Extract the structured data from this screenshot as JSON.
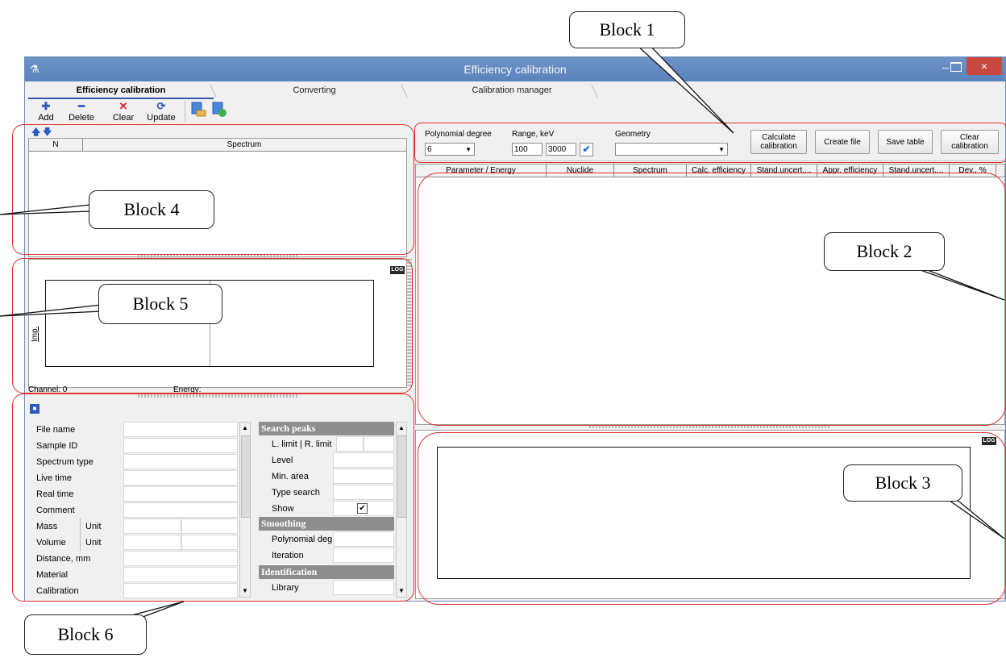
{
  "window": {
    "title": "Efficiency calibration",
    "controls": {
      "minimize": "–",
      "maximize": "☐",
      "close": "×"
    }
  },
  "tabs": [
    "Efficiency calibration",
    "Converting",
    "Calibration manager"
  ],
  "toolbar": {
    "add": "Add",
    "delete": "Delete",
    "clear": "Clear",
    "update": "Update"
  },
  "spectra_list": {
    "headers": {
      "n": "N",
      "spectrum": "Spectrum"
    }
  },
  "spectrum_view": {
    "log": "LOG",
    "y_label": "Imp.",
    "channel": "Channel: 0",
    "energy": "Energy:"
  },
  "properties": {
    "rows": [
      "File name",
      "Sample ID",
      "Spectrum type",
      "Live time",
      "Real time",
      "Comment",
      "Mass",
      "Volume",
      "Distance, mm",
      "Material",
      "Calibration"
    ],
    "unit_label": "Unit"
  },
  "settings": {
    "search_peaks": "Search peaks",
    "l_limit": "L. limit",
    "r_limit": "R. limit",
    "level": "Level",
    "min_area": "Min. area",
    "type_search": "Type search",
    "show": "Show",
    "show_checked": true,
    "smoothing": "Smoothing",
    "polynomial_deg": "Polynomial deg",
    "iteration": "Iteration",
    "identification": "Identification",
    "library": "Library"
  },
  "calibration_controls": {
    "polynomial_degree_label": "Polynomial degree",
    "polynomial_degree_value": "6",
    "range_label": "Range, keV",
    "range_min": "100",
    "range_max": "3000",
    "geometry_label": "Geometry",
    "geometry_value": "",
    "calculate_button": "Calculate calibration",
    "create_file_button": "Create file",
    "save_table_button": "Save table",
    "clear_calibration_button": "Clear calibration"
  },
  "results_table": {
    "headers": [
      "Parameter / Energy",
      "Nuclide",
      "Spectrum",
      "Calc. efficiency",
      "Stand.uncert....",
      "Appr. efficiency",
      "Stand.uncert....",
      "Dev., %"
    ]
  },
  "efficiency_plot": {
    "log": "LOG"
  },
  "annotations": {
    "block1": "Block 1",
    "block2": "Block 2",
    "block3": "Block 3",
    "block4": "Block 4",
    "block5": "Block 5",
    "block6": "Block 6"
  },
  "colors": {
    "accent_red": "#e03030",
    "title_blue": "#5b82bb",
    "close_red": "#c9483f"
  }
}
